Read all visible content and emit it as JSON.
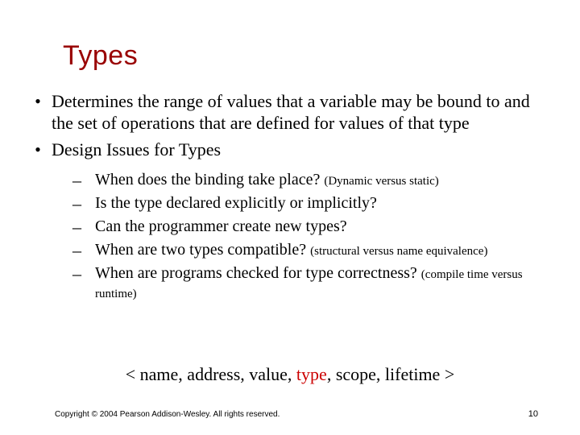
{
  "title": "Types",
  "bullets": [
    "Determines the range of values that a variable may be bound to and the set of operations that are defined for values of that type",
    "Design Issues for Types"
  ],
  "sub": [
    {
      "main": "When does the binding take place? ",
      "note": "(Dynamic versus static)"
    },
    {
      "main": "Is the type declared explicitly or implicitly?",
      "note": ""
    },
    {
      "main": "Can the programmer create new types?",
      "note": ""
    },
    {
      "main": "When are two types compatible? ",
      "note": "(structural versus name equivalence)"
    },
    {
      "main": "When are programs checked for type correctness? ",
      "note": "(compile time versus runtime)"
    }
  ],
  "tuple": {
    "open": "< ",
    "p1": "name, address, value, ",
    "hl": "type",
    "p2": ", scope, lifetime ",
    "close": ">"
  },
  "footer": "Copyright © 2004 Pearson Addison-Wesley. All rights reserved.",
  "pagenum": "10"
}
